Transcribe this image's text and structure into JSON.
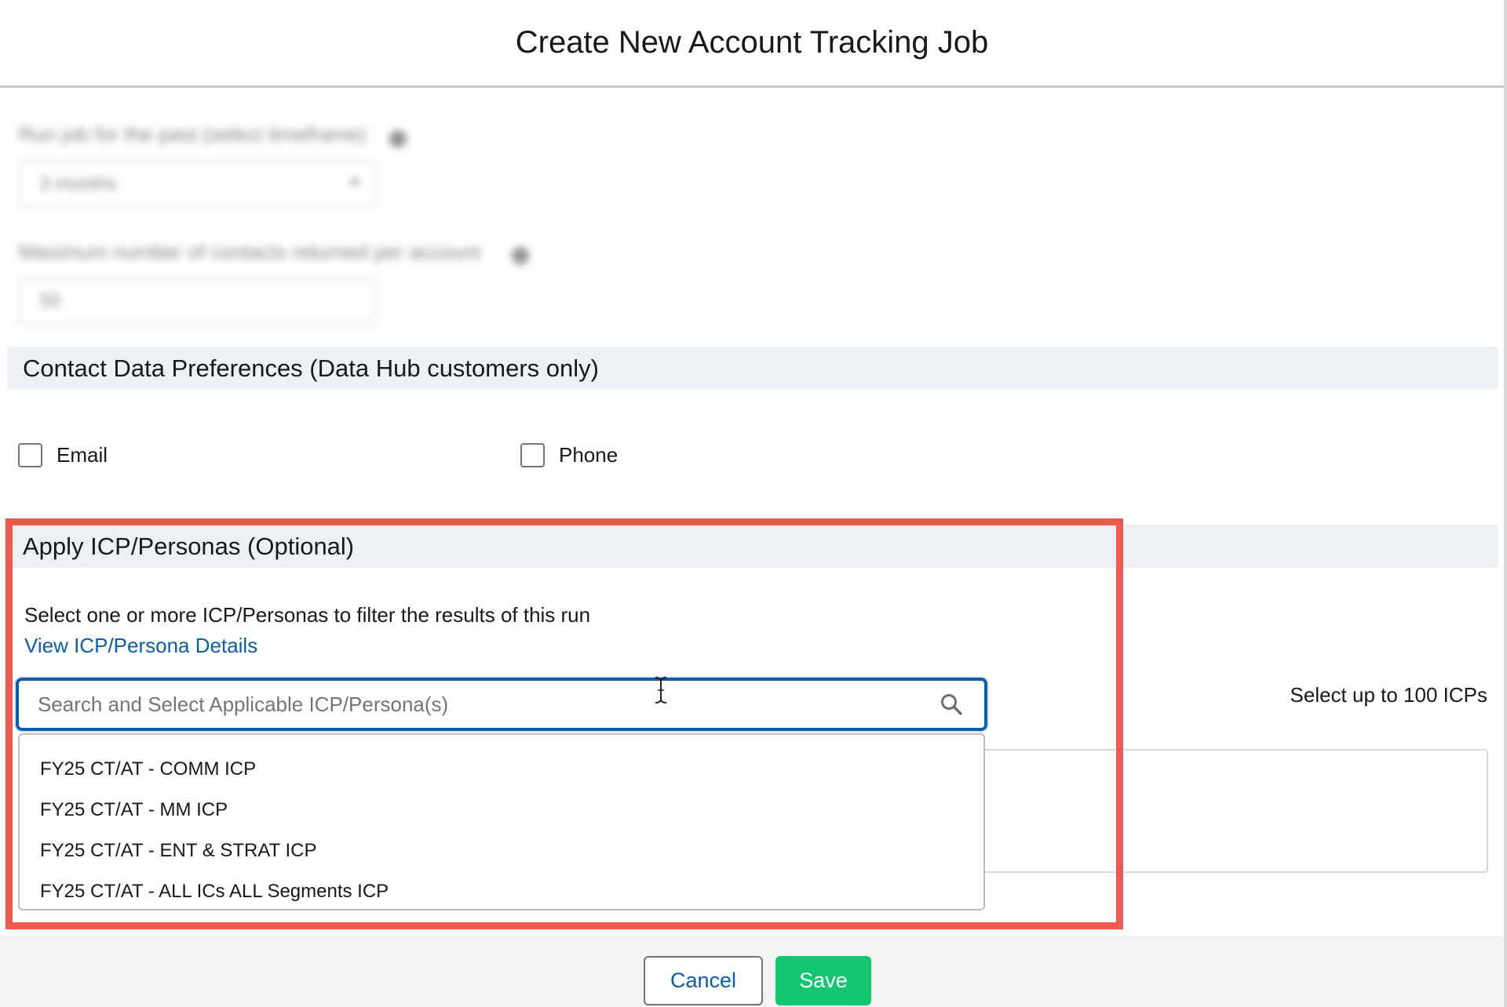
{
  "modal": {
    "title": "Create New Account Tracking Job"
  },
  "blurred_fields": {
    "timeframe_label": "Run job for the past (select timeframe)",
    "timeframe_value": "3 months",
    "max_contacts_label": "Maximum number of contacts returned per account",
    "max_contacts_value": "50"
  },
  "contact_prefs": {
    "title": "Contact Data Preferences (Data Hub customers only)",
    "email_label": "Email",
    "phone_label": "Phone",
    "email_checked": false,
    "phone_checked": false
  },
  "icp_section": {
    "title": "Apply ICP/Personas (Optional)",
    "helper_text": "Select one or more ICP/Personas to filter the results of this run",
    "details_link": "View ICP/Persona Details",
    "search_placeholder": "Search and Select Applicable ICP/Persona(s)",
    "search_value": "",
    "limit_text": "Select up to 100 ICPs",
    "options": [
      "FY25 CT/AT - COMM ICP",
      "FY25 CT/AT - MM ICP",
      "FY25 CT/AT - ENT & STRAT ICP",
      "FY25 CT/AT - ALL ICs ALL Segments ICP"
    ]
  },
  "footer": {
    "cancel_label": "Cancel",
    "save_label": "Save"
  },
  "icons": {
    "search": "search-icon",
    "cursor": "text-cursor-icon",
    "info": "info-icon",
    "dropdown_caret": "chevron-down-icon"
  },
  "colors": {
    "brand_blue": "#0b5cab",
    "save_green": "#13c66f",
    "highlight_red": "#ee5a4f",
    "section_bg": "#edf0f4"
  }
}
